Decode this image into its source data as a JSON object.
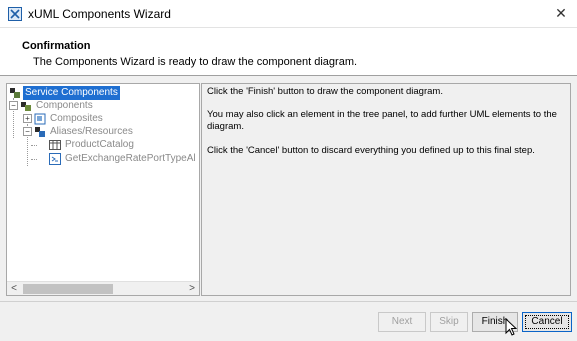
{
  "window": {
    "title": "xUML Components Wizard",
    "close_glyph": "✕"
  },
  "header": {
    "title": "Confirmation",
    "description": "The Components Wizard is ready to draw the component diagram."
  },
  "tree": {
    "nodes": [
      {
        "label": "Service Components",
        "icon": "service-components-icon",
        "selected": true
      },
      {
        "label": "Components",
        "icon": "components-icon",
        "selected": false
      },
      {
        "label": "Composites",
        "icon": "composites-icon",
        "selected": false
      },
      {
        "label": "Aliases/Resources",
        "icon": "aliases-icon",
        "selected": false
      },
      {
        "label": "ProductCatalog",
        "icon": "table-icon",
        "selected": false
      },
      {
        "label": "GetExchangeRatePortTypeAl",
        "icon": "port-type-icon",
        "selected": false
      }
    ],
    "scroll_left": "<",
    "scroll_right": ">"
  },
  "info": {
    "lines": [
      "Click the 'Finish' button to draw the component diagram.",
      "You may also click an element in the tree panel, to add further UML elements to the diagram.",
      "Click the 'Cancel' button to discard everything you defined up to this final step."
    ]
  },
  "buttons": {
    "next": "Next",
    "skip": "Skip",
    "finish": "Finish",
    "cancel": "Cancel"
  },
  "colors": {
    "selection": "#1f6fd1",
    "disabled_text": "#8a8a8a"
  }
}
